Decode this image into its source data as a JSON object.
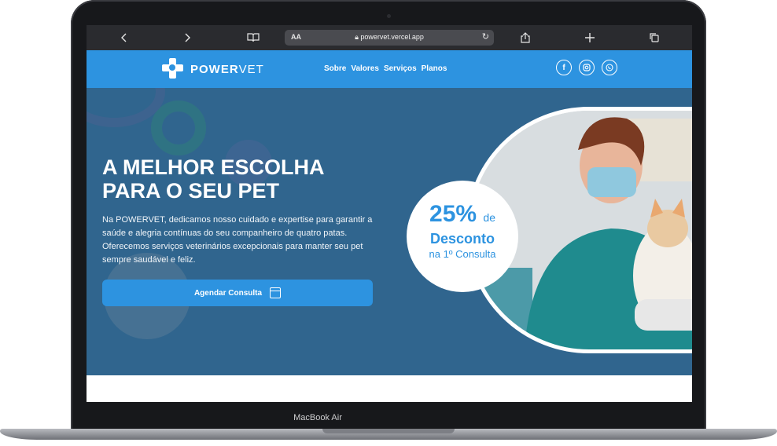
{
  "browser": {
    "address_aa": "AA",
    "url": "powervet.vercel.app",
    "icons": [
      "back-icon",
      "forward-icon",
      "book-icon",
      "lock-icon",
      "reload-icon",
      "share-icon",
      "plus-icon",
      "tabs-icon"
    ]
  },
  "site": {
    "logo": {
      "brand": "POWER",
      "brand_suffix": "VET"
    },
    "nav": [
      "Sobre",
      "Valores",
      "Serviços",
      "Planos"
    ],
    "social": [
      "facebook-icon",
      "instagram-icon",
      "whatsapp-icon"
    ]
  },
  "hero": {
    "title_line1": "A MELHOR ESCOLHA",
    "title_line2": "PARA O SEU PET",
    "description": "Na POWERVET, dedicamos nosso cuidado e expertise para garantir a saúde e alegria contínuas do seu companheiro de quatro patas. Oferecemos serviços veterinários excepcionais para manter seu pet sempre saudável e feliz.",
    "cta_label": "Agendar Consulta",
    "badge": {
      "percent": "25%",
      "de": "de",
      "desconto": "Desconto",
      "consulta": "na 1º Consulta"
    }
  },
  "device": {
    "label": "MacBook Air"
  },
  "colors": {
    "brand_blue": "#2d93e0",
    "hero_overlay": "#265c8a",
    "bezel": "#17181b"
  }
}
